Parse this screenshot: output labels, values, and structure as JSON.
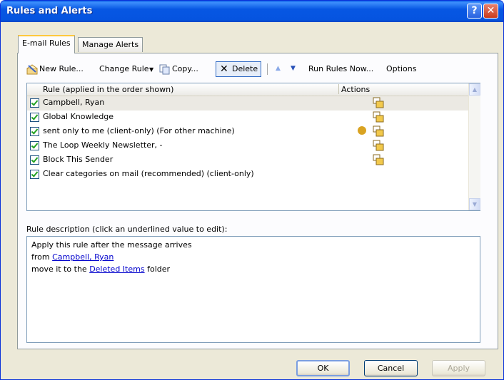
{
  "window": {
    "title": "Rules and Alerts",
    "help_glyph": "?",
    "close_glyph": "✕"
  },
  "tabs": [
    {
      "label": "E-mail Rules",
      "active": true
    },
    {
      "label": "Manage Alerts",
      "active": false
    }
  ],
  "toolbar": {
    "new_rule": "New Rule...",
    "change_rule": "Change Rule",
    "copy": "Copy...",
    "delete": "Delete",
    "move_up": "▲",
    "move_down": "▼",
    "run_rules": "Run Rules Now...",
    "options": "Options"
  },
  "rules_list": {
    "columns": [
      "Rule (applied in the order shown)",
      "Actions"
    ],
    "rows": [
      {
        "name": "Campbell, Ryan",
        "checked": true,
        "selected": true,
        "icons": [
          "rule-action-icon"
        ]
      },
      {
        "name": "Global Knowledge",
        "checked": true,
        "selected": false,
        "icons": [
          "rule-action-icon"
        ]
      },
      {
        "name": "sent only to me  (client-only)  (For other machine)",
        "checked": true,
        "selected": false,
        "icons": [
          "sound-icon",
          "rule-action-icon"
        ]
      },
      {
        "name": "The Loop Weekly Newsletter, -",
        "checked": true,
        "selected": false,
        "icons": [
          "rule-action-icon"
        ]
      },
      {
        "name": "Block This Sender",
        "checked": true,
        "selected": false,
        "icons": [
          "rule-action-icon"
        ]
      },
      {
        "name": "Clear categories on mail (recommended)  (client-only)",
        "checked": true,
        "selected": false,
        "icons": []
      }
    ]
  },
  "description": {
    "label": "Rule description (click an underlined value to edit):",
    "line1": "Apply this rule after the message arrives",
    "line2_prefix": "from ",
    "line2_link": "Campbell, Ryan",
    "line3_prefix": "move it to the ",
    "line3_link": "Deleted Items",
    "line3_suffix": " folder"
  },
  "buttons": {
    "ok": "OK",
    "cancel": "Cancel",
    "apply": "Apply"
  },
  "colors": {
    "titlebar": "#0554e0",
    "dialog_bg": "#ece9d8",
    "link": "#0000cc",
    "selection": "#ebe9e3"
  }
}
